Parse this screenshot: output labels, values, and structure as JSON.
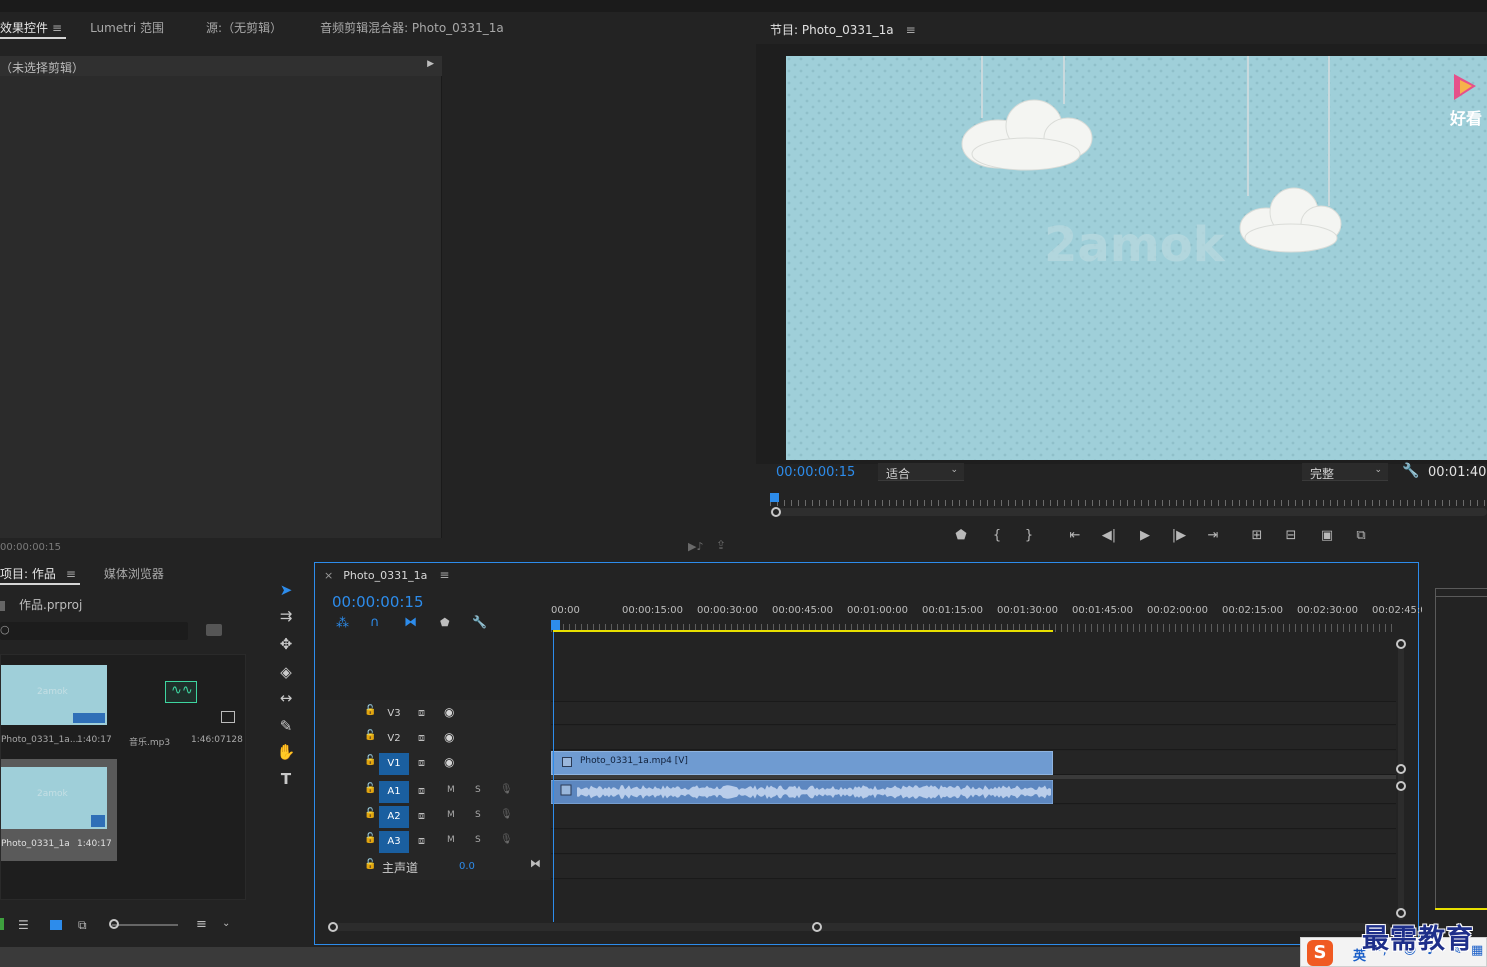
{
  "effect_panel": {
    "tabs": [
      {
        "label": "效果控件",
        "active": true
      },
      {
        "label": "Lumetri 范围",
        "active": false
      },
      {
        "label": "源:（无剪辑）",
        "active": false
      },
      {
        "label": "音频剪辑混合器: Photo_0331_1a",
        "active": false
      }
    ],
    "no_clip_label": "（未选择剪辑）",
    "timecode": "00:00:00:15"
  },
  "program_monitor": {
    "title": "节目: Photo_0331_1a",
    "timecode": "00:00:00:15",
    "zoom_select": "适合",
    "quality_select": "完整",
    "duration": "00:01:40:",
    "watermark_brand": "好看",
    "watermark_text": "2amok"
  },
  "project_panel": {
    "tabs": [
      {
        "label": "项目: 作品",
        "active": true
      },
      {
        "label": "媒体浏览器",
        "active": false
      }
    ],
    "project_file": "作品.prproj",
    "items": [
      {
        "name": "Photo_0331_1a...",
        "duration": "1:40:17"
      },
      {
        "name": "音乐.mp3",
        "duration": "1:46:07128"
      },
      {
        "name": "Photo_0331_1a",
        "duration": "1:40:17"
      }
    ],
    "thumb_watermark": "2amok"
  },
  "timeline": {
    "tab_label": "Photo_0331_1a",
    "timecode": "00:00:00:15",
    "ruler": [
      "00:00",
      "00:00:15:00",
      "00:00:30:00",
      "00:00:45:00",
      "00:01:00:00",
      "00:01:15:00",
      "00:01:30:00",
      "00:01:45:00",
      "00:02:00:00",
      "00:02:15:00",
      "00:02:30:00",
      "00:02:45:0"
    ],
    "video_tracks": [
      "V3",
      "V2",
      "V1"
    ],
    "audio_tracks": [
      "A1",
      "A2",
      "A3"
    ],
    "mute_label": "M",
    "solo_label": "S",
    "master_label": "主声道",
    "master_value": "0.0",
    "video_clip_label": "Photo_0331_1a.mp4 [V]"
  },
  "overlay": {
    "logo_text": "最需教育",
    "ime_lang": "英"
  },
  "colors": {
    "accent_blue": "#2d8ceb",
    "clip_video": "#6f9bd1",
    "clip_audio": "#5d87c0",
    "work_area": "#e8e000",
    "frame_bg": "#9fcfd9"
  }
}
